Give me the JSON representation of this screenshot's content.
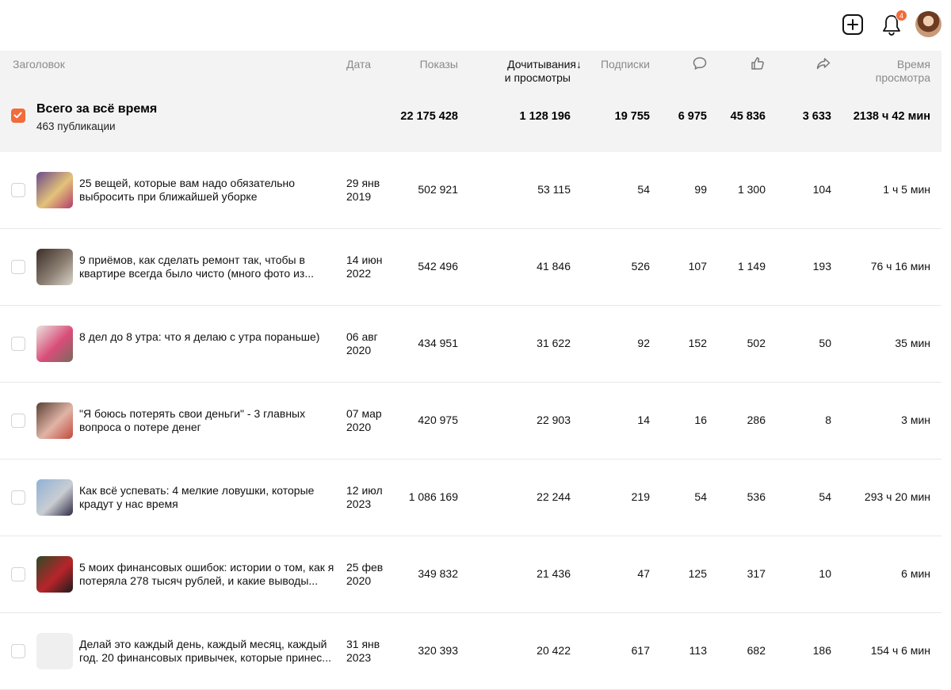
{
  "notifications": {
    "count": "4"
  },
  "table": {
    "headers": {
      "title": "Заголовок",
      "date": "Дата",
      "views": "Показы",
      "reads_line1": "Дочитывания↓",
      "reads_line2": "и просмотры",
      "subscriptions": "Подписки",
      "time_line1": "Время",
      "time_line2": "просмотра"
    },
    "header_icons": [
      "comment-icon",
      "like-icon",
      "share-icon"
    ],
    "total": {
      "title": "Всего за всё время",
      "subtitle": "463 публикации",
      "views": "22 175 428",
      "reads": "1 128 196",
      "subscriptions": "19 755",
      "comments": "6 975",
      "likes": "45 836",
      "shares": "3 633",
      "time": "2138 ч 42 мин"
    },
    "rows": [
      {
        "title": "25 вещей, которые вам надо обязательно выбросить при ближайшей уборке",
        "date_line1": "29 янв",
        "date_line2": "2019",
        "views": "502 921",
        "reads": "53 115",
        "subscriptions": "54",
        "comments": "99",
        "likes": "1 300",
        "shares": "104",
        "time": "1 ч 5 мин",
        "thumb": [
          "#6b4a8c",
          "#e3c27a",
          "#b23b6a"
        ]
      },
      {
        "title": "9 приёмов, как сделать ремонт так, чтобы в квартире всегда было чисто (много фото из...",
        "date_line1": "14 июн",
        "date_line2": "2022",
        "views": "542 496",
        "reads": "41 846",
        "subscriptions": "526",
        "comments": "107",
        "likes": "1 149",
        "shares": "193",
        "time": "76 ч 16 мин",
        "thumb": [
          "#3a2e28",
          "#8a7d70",
          "#d9d3c9"
        ]
      },
      {
        "title": "8 дел до 8 утра: что я делаю с утра пораньше)",
        "date_line1": "06 авг",
        "date_line2": "2020",
        "views": "434 951",
        "reads": "31 622",
        "subscriptions": "92",
        "comments": "152",
        "likes": "502",
        "shares": "50",
        "time": "35 мин",
        "thumb": [
          "#e9e4de",
          "#d94d7a",
          "#7a6a5c"
        ]
      },
      {
        "title": "\"Я боюсь потерять свои деньги\" - 3 главных вопроса о потере денег",
        "date_line1": "07 мар",
        "date_line2": "2020",
        "views": "420 975",
        "reads": "22 903",
        "subscriptions": "14",
        "comments": "16",
        "likes": "286",
        "shares": "8",
        "time": "3 мин",
        "thumb": [
          "#5a4034",
          "#e0b4a6",
          "#c2483d"
        ]
      },
      {
        "title": "Как всё успевать: 4 мелкие ловушки, которые крадут у нас время",
        "date_line1": "12 июл",
        "date_line2": "2023",
        "views": "1 086 169",
        "reads": "22 244",
        "subscriptions": "219",
        "comments": "54",
        "likes": "536",
        "shares": "54",
        "time": "293 ч 20 мин",
        "thumb": [
          "#8fb1d6",
          "#c9cdd2",
          "#2e2a44"
        ]
      },
      {
        "title": "5 моих финансовых ошибок: истории о том, как я потеряла 278 тысяч рублей, и какие выводы...",
        "date_line1": "25 фев",
        "date_line2": "2020",
        "views": "349 832",
        "reads": "21 436",
        "subscriptions": "47",
        "comments": "125",
        "likes": "317",
        "shares": "10",
        "time": "6 мин",
        "thumb": [
          "#2e4a26",
          "#b8242a",
          "#1c1c1c"
        ]
      },
      {
        "title": "Делай это каждый день, каждый месяц, каждый год. 20 финансовых привычек, которые принес...",
        "date_line1": "31 янв",
        "date_line2": "2023",
        "views": "320 393",
        "reads": "20 422",
        "subscriptions": "617",
        "comments": "113",
        "likes": "682",
        "shares": "186",
        "time": "154 ч 6 мин",
        "thumb": [
          "#efefef",
          "#efefef",
          "#efefef"
        ]
      }
    ]
  },
  "colors": {
    "accent": "#f26b3a",
    "header_bg": "#f3f3f3",
    "muted_text": "#8a8a8a"
  }
}
